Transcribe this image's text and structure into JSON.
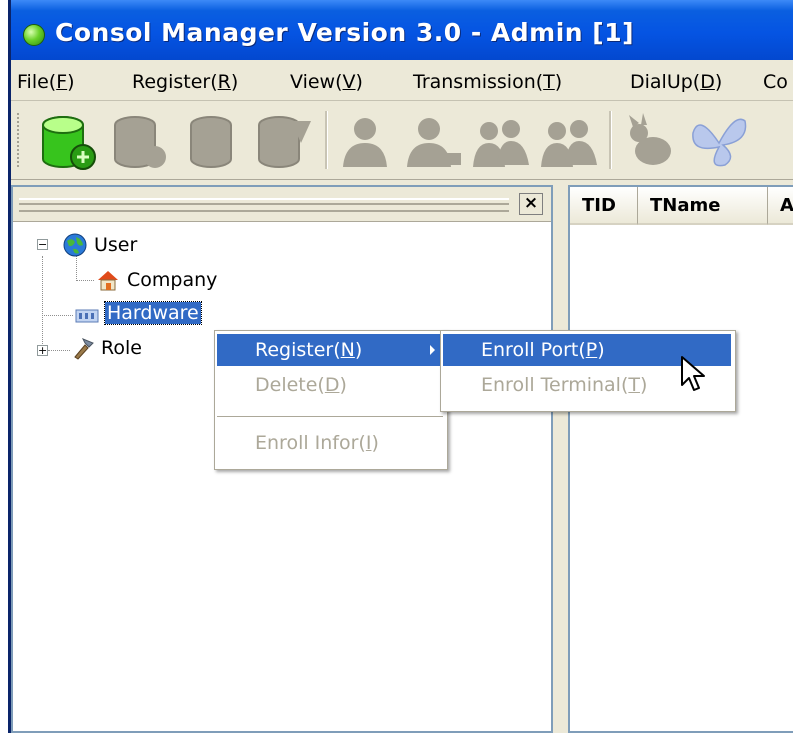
{
  "window": {
    "title": "Consol Manager Version 3.0 - Admin [1]"
  },
  "menubar": {
    "items": [
      {
        "label": "File(",
        "key": "F",
        "suffix": ")"
      },
      {
        "label": "Register(",
        "key": "R",
        "suffix": ")"
      },
      {
        "label": "View(",
        "key": "V",
        "suffix": ")"
      },
      {
        "label": "Transmission(",
        "key": "T",
        "suffix": ")"
      },
      {
        "label": "DialUp(",
        "key": "D",
        "suffix": ")"
      },
      {
        "label": "Co",
        "key": "",
        "suffix": ""
      }
    ]
  },
  "toolbar": {
    "icons": [
      "database-add-icon",
      "database-icon",
      "cylinder-icon",
      "database-refresh-icon",
      "user-icon",
      "user-edit-icon",
      "users-icon",
      "users-group-icon",
      "rabbit-icon",
      "butterfly-icon"
    ]
  },
  "tree": {
    "nodes": [
      {
        "label": "User",
        "icon": "globe-icon",
        "expander": "−"
      },
      {
        "label": "Company",
        "icon": "house-icon"
      },
      {
        "label": "Hardware",
        "icon": "hardware-icon"
      },
      {
        "label": "Role",
        "icon": "tools-icon",
        "expander": "+"
      }
    ]
  },
  "list": {
    "columns": [
      "TID",
      "TName",
      "Ac"
    ]
  },
  "context_menu": {
    "items": [
      {
        "label": "Register(",
        "key": "N",
        "suffix": ")",
        "state": "highlighted"
      },
      {
        "label": "Delete(",
        "key": "D",
        "suffix": ")",
        "state": "disabled"
      },
      {
        "label": "Enroll Infor(",
        "key": "I",
        "suffix": ")",
        "state": "disabled"
      }
    ]
  },
  "submenu": {
    "items": [
      {
        "label": "Enroll Port(",
        "key": "P",
        "suffix": ")",
        "state": "highlighted"
      },
      {
        "label": "Enroll Terminal(",
        "key": "T",
        "suffix": ")",
        "state": "disabled"
      }
    ]
  },
  "colors": {
    "titlebar": "#0554e3",
    "highlight": "#316ac5",
    "disabled_text": "#aca899",
    "window_bg": "#ece9d8"
  }
}
